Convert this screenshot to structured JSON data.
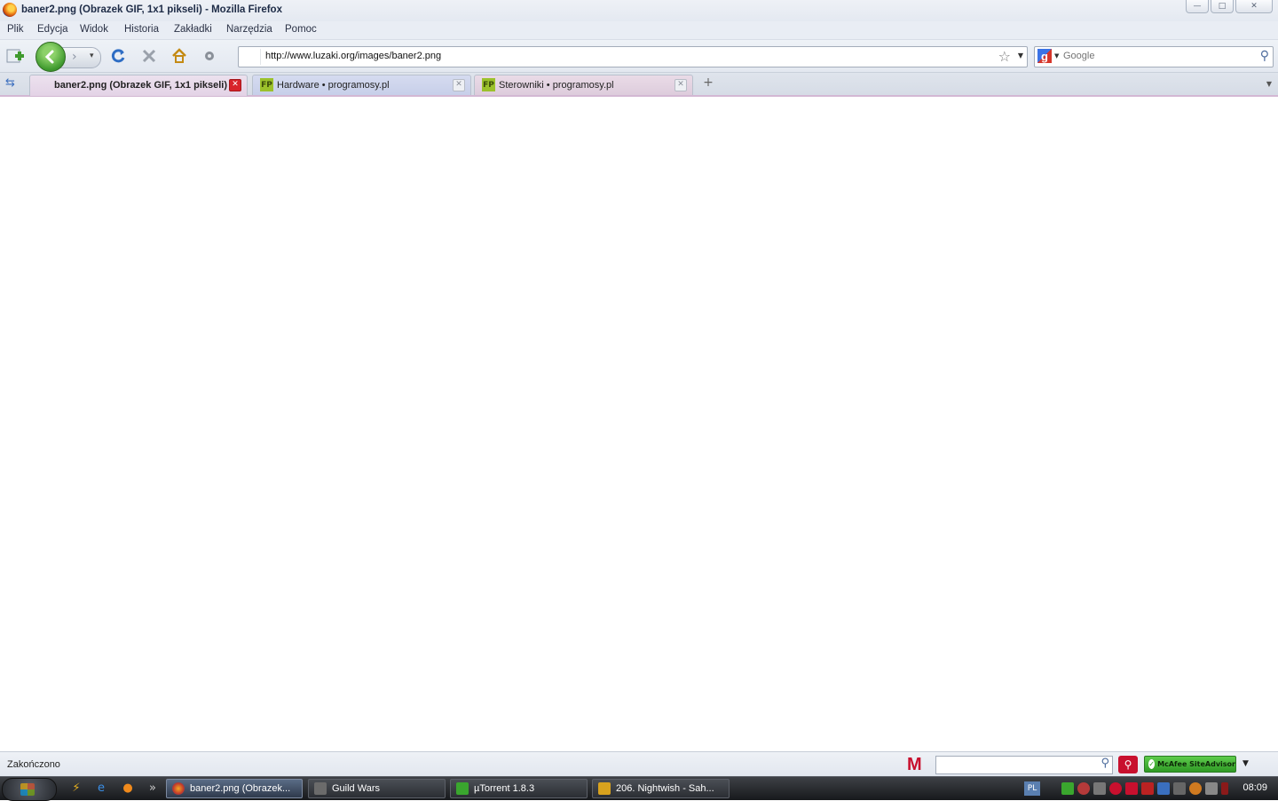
{
  "window": {
    "title": "baner2.png (Obrazek GIF, 1x1 pikseli) - Mozilla Firefox",
    "minimize": "—",
    "maximize": "□",
    "close": "✕"
  },
  "menu": [
    "Plik",
    "Edycja",
    "Widok",
    "Historia",
    "Zakładki",
    "Narzędzia",
    "Pomoc"
  ],
  "navbar": {
    "url": "http://www.luzaki.org/images/baner2.png",
    "search_engine_logo": "g",
    "search_placeholder": "Google"
  },
  "tabs": [
    {
      "label": "baner2.png (Obrazek GIF, 1x1 pikseli)",
      "active": true
    },
    {
      "label": "Hardware • programosy.pl",
      "active": false,
      "favicon": "FP"
    },
    {
      "label": "Sterowniki • programosy.pl",
      "active": false,
      "favicon": "FP"
    }
  ],
  "statusbar": {
    "status": "Zakończono",
    "mcafee_logo": "M",
    "siteadvisor_label": "McAfee SiteAdvisor"
  },
  "taskbar": {
    "tasks": [
      {
        "label": "baner2.png (Obrazek...",
        "active": true
      },
      {
        "label": "Guild Wars",
        "active": false
      },
      {
        "label": "µTorrent 1.8.3",
        "active": false
      },
      {
        "label": "206. Nightwish - Sah...",
        "active": false
      }
    ],
    "language": "PL",
    "clock": "08:09",
    "quicklaunch_more": "»"
  },
  "colors": {
    "accent_green": "#3f9a2e",
    "tab_active": "#e3d3e6",
    "close_red": "#d8242a"
  }
}
